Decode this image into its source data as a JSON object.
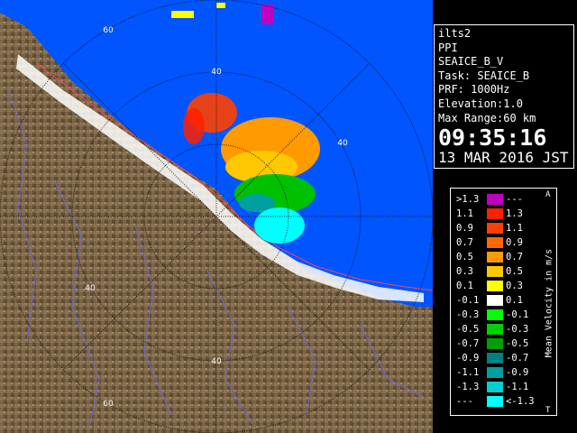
{
  "info": {
    "station": "ilts2",
    "product": "PPI",
    "field": "SEAICE_B_V",
    "task": "Task: SEAICE_B",
    "prf": "PRF: 1000Hz",
    "elevation": "Elevation:1.0",
    "max_range": "Max Range:60 km",
    "time": "09:35:16",
    "date": "13 MAR 2016 JST"
  },
  "range_rings": {
    "labels": [
      "60",
      "40",
      "40",
      "40",
      "40",
      "60"
    ]
  },
  "legend": {
    "title": "Mean Velocity in m/s",
    "top_marker": "A",
    "bottom_marker": "T",
    "bins": [
      {
        "low": ">1.3",
        "high": "---",
        "color": "#c000c0"
      },
      {
        "low": "1.1",
        "high": "1.3",
        "color": "#ff2000"
      },
      {
        "low": "0.9",
        "high": "1.1",
        "color": "#ff4000"
      },
      {
        "low": "0.7",
        "high": "0.9",
        "color": "#ff6a00"
      },
      {
        "low": "0.5",
        "high": "0.7",
        "color": "#ff9a00"
      },
      {
        "low": "0.3",
        "high": "0.5",
        "color": "#ffc800"
      },
      {
        "low": "0.1",
        "high": "0.3",
        "color": "#ffff00"
      },
      {
        "low": "-0.1",
        "high": "0.1",
        "color": "#ffffff"
      },
      {
        "low": "-0.3",
        "high": "-0.1",
        "color": "#00ff00"
      },
      {
        "low": "-0.5",
        "high": "-0.3",
        "color": "#00d000"
      },
      {
        "low": "-0.7",
        "high": "-0.5",
        "color": "#00a000"
      },
      {
        "low": "-0.9",
        "high": "-0.7",
        "color": "#008080"
      },
      {
        "low": "-1.1",
        "high": "-0.9",
        "color": "#00a0a0"
      },
      {
        "low": "-1.3",
        "high": "-1.1",
        "color": "#00d0d0"
      },
      {
        "low": "---",
        "high": "<-1.3",
        "color": "#00ffff"
      }
    ]
  },
  "colors": {
    "sea": "#0055ff",
    "land": "#7a6446",
    "snow": "#ffffff",
    "coast": "#ff4060"
  }
}
